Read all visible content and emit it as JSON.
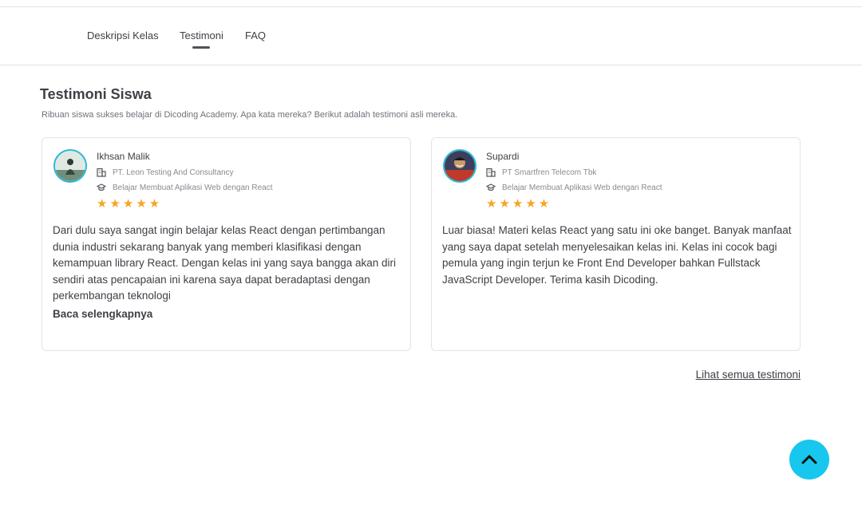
{
  "tabs": [
    {
      "label": "Deskripsi Kelas",
      "active": false
    },
    {
      "label": "Testimoni",
      "active": true
    },
    {
      "label": "FAQ",
      "active": false
    }
  ],
  "section": {
    "title": "Testimoni Siswa",
    "subtitle": "Ribuan siswa sukses belajar di Dicoding Academy. Apa kata mereka? Berikut adalah testimoni asli mereka."
  },
  "testimonials": [
    {
      "name": "Ikhsan Malik",
      "company": "PT. Leon Testing And Consultancy",
      "course": "Belajar Membuat Aplikasi Web dengan React",
      "rating": 5,
      "stars": "★★★★★",
      "text": "Dari dulu saya sangat ingin belajar kelas React dengan pertimbangan dunia industri sekarang banyak yang memberi klasifikasi dengan kemampuan library React. Dengan kelas ini yang saya bangga akan diri sendiri atas pencapaian ini karena saya dapat beradaptasi dengan perkembangan teknologi",
      "read_more": "Baca selengkapnya"
    },
    {
      "name": "Supardi",
      "company": "PT Smartfren Telecom Tbk",
      "course": "Belajar Membuat Aplikasi Web dengan React",
      "rating": 5,
      "stars": "★★★★★",
      "text": "Luar biasa! Materi kelas React yang satu ini oke banget. Banyak manfaat yang saya dapat setelah menyelesaikan kelas ini. Kelas ini cocok bagi pemula yang ingin terjun ke Front End Developer bahkan Fullstack JavaScript Developer. Terima kasih Dicoding."
    }
  ],
  "see_all_label": "Lihat semua testimoni",
  "icons": {
    "company": "building-icon",
    "course": "graduation-cap-icon",
    "back_to_top": "chevron-up-icon"
  },
  "colors": {
    "accent": "#17c7ee",
    "star": "#f5a623",
    "avatar_border": "#2bb8d6"
  }
}
